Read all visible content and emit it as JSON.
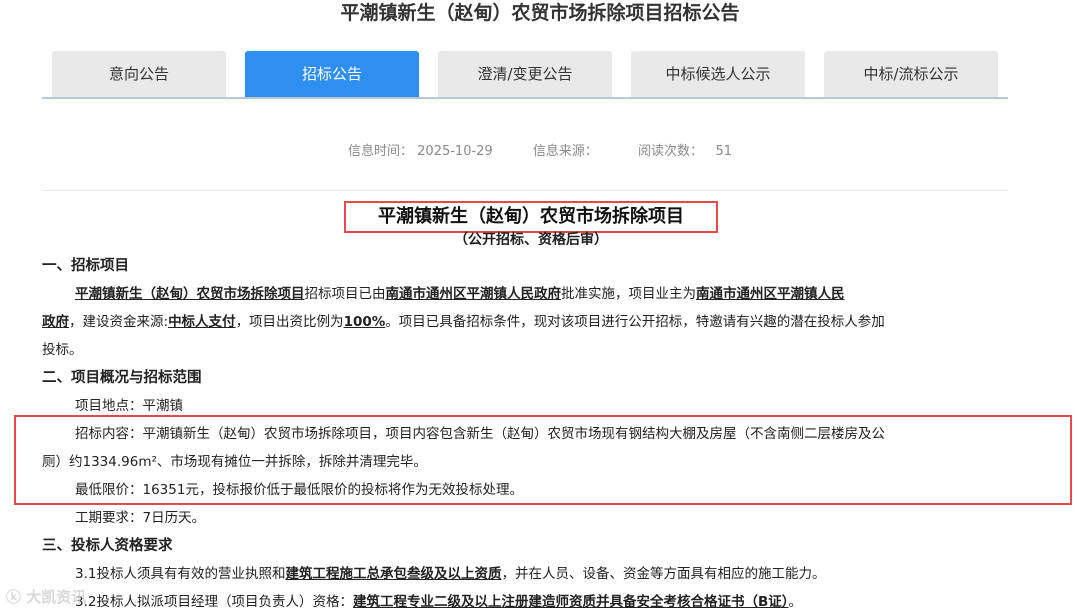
{
  "page_title": "平潮镇新生（赵甸）农贸市场拆除项目招标公告",
  "tabs": [
    {
      "label": "意向公告"
    },
    {
      "label": "招标公告",
      "active": true
    },
    {
      "label": "澄清/变更公告"
    },
    {
      "label": "中标候选人公示"
    },
    {
      "label": "中标/流标公示"
    }
  ],
  "meta": {
    "time_label": "信息时间：",
    "time_value": "2025-10-29",
    "source_label": "信息来源：",
    "views_label": "阅读次数：",
    "views_value": "51"
  },
  "doc": {
    "title": "平潮镇新生（赵甸）农贸市场拆除项目",
    "subtitle": "（公开招标、资格后审）",
    "s1_heading": "一、招标项目",
    "p1_project": "平潮镇新生（赵甸）农贸市场拆除项目",
    "p1_t1": "招标项目已由",
    "p1_gov1": "南通市通州区平潮镇人民政府",
    "p1_t2": "批准实施，项目业主为",
    "p1_gov2a": "南通市通州区平潮镇人民",
    "p1_gov2b": "政府",
    "p1_t3": "，建设资金来源:",
    "p1_fund": "中标人支付",
    "p1_t4": "，项目出资比例为",
    "p1_ratio": "100%",
    "p1_t5": "。项目已具备招标条件，现对该项目进行公开招标，特邀请有兴趣的潜在投标人参加",
    "p1_t6": "投标。",
    "s2_heading": "二、项目概况与招标范围",
    "location": "项目地点：平潮镇",
    "content_l1": "招标内容：平潮镇新生（赵甸）农贸市场拆除项目，项目内容包含新生（赵甸）农贸市场现有钢结构大棚及房屋（不含南侧二层楼房及公",
    "content_l2": "厕）约1334.96m²、市场现有摊位一并拆除，拆除并清理完毕。",
    "min_price": "最低限价：16351元，投标报价低于最低限价的投标将作为无效投标处理。",
    "duration": "工期要求：7日历天。",
    "s3_heading": "三、投标人资格要求",
    "q1_t1": "3.1投标人须具有有效的营业执照和",
    "q1_req": "建筑工程施工总承包叁级及以上资质",
    "q1_t2": "，并在人员、设备、资金等方面具有相应的施工能力。",
    "q2_t1": "3.2投标人拟派项目经理（项目负责人）资格：",
    "q2_req": "建筑工程专业二级及以上注册建造师资质并具备安全考核合格证书（B证）",
    "q2_t2": "。"
  },
  "watermark": "大凯资讯"
}
